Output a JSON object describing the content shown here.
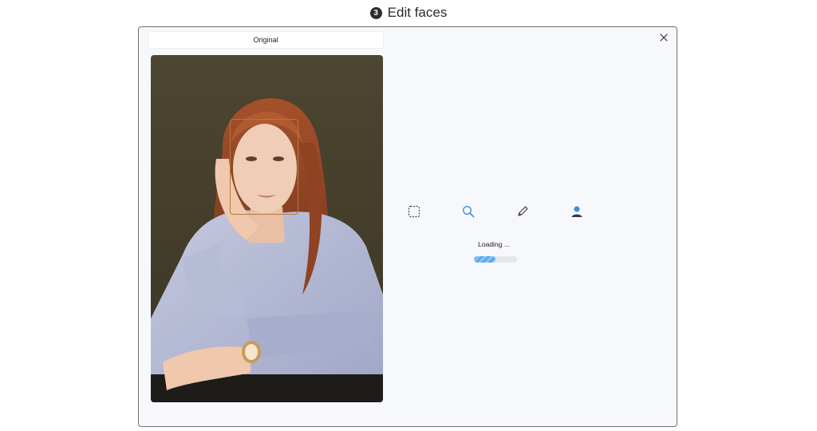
{
  "header": {
    "step_number": "3",
    "title": "Edit faces"
  },
  "modal": {
    "tab_label": "Original",
    "close_icon": "close-icon",
    "tools": [
      {
        "name": "select-region-icon",
        "active": false
      },
      {
        "name": "search-icon",
        "active": true
      },
      {
        "name": "pencil-icon",
        "active": false
      },
      {
        "name": "person-icon",
        "active": false
      }
    ],
    "loading": {
      "text": "Loading ...",
      "progress": 0.5
    }
  },
  "colors": {
    "accent": "#5aa8ec",
    "face_box": "#b5793f",
    "modal_bg": "#f7f8fb"
  }
}
